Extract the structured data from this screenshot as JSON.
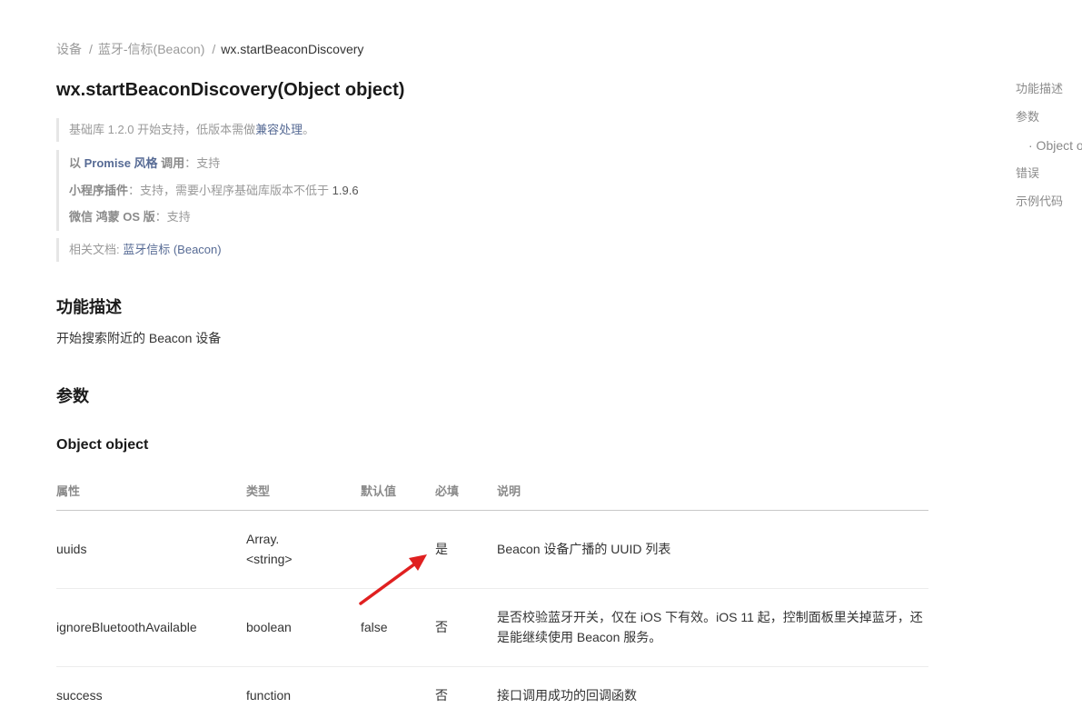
{
  "breadcrumb": {
    "items": [
      "设备",
      "蓝牙-信标(Beacon)"
    ],
    "separator": "/",
    "current": "wx.startBeaconDiscovery"
  },
  "title": "wx.startBeaconDiscovery(Object object)",
  "support_note": {
    "prefix": "基础库 1.2.0 开始支持，低版本需做",
    "link": "兼容处理",
    "suffix": "。"
  },
  "compat": {
    "promise": {
      "a": "以 ",
      "b": "Promise 风格",
      "c": " 调用",
      "colon": "：",
      "value": "支持"
    },
    "plugin": {
      "label": "小程序插件",
      "colon": "：",
      "value": "支持，需要小程序基础库版本不低于 ",
      "version": "1.9.6"
    },
    "harmony": {
      "label": "微信 鸿蒙 OS 版",
      "colon": "：",
      "value": "支持"
    }
  },
  "related": {
    "label": "相关文档: ",
    "link": "蓝牙信标 (Beacon)"
  },
  "sections": {
    "function_title": "功能描述",
    "function_desc": "开始搜索附近的 Beacon 设备",
    "params_title": "参数",
    "object_title": "Object object"
  },
  "table": {
    "headers": [
      "属性",
      "类型",
      "默认值",
      "必填",
      "说明"
    ],
    "rows": [
      {
        "attr": "uuids",
        "type": "Array.<string>",
        "default": "",
        "required": "是",
        "desc": "Beacon 设备广播的 UUID 列表"
      },
      {
        "attr": "ignoreBluetoothAvailable",
        "type": "boolean",
        "default": "false",
        "required": "否",
        "desc": "是否校验蓝牙开关，仅在 iOS 下有效。iOS 11 起，控制面板里关掉蓝牙，还是能继续使用 Beacon 服务。"
      },
      {
        "attr": "success",
        "type": "function",
        "default": "",
        "required": "否",
        "desc": "接口调用成功的回调函数"
      }
    ]
  },
  "toc": {
    "items": [
      "功能描述",
      "参数",
      "· Object object",
      "错误",
      "示例代码"
    ]
  },
  "colors": {
    "link": "#576b95",
    "annotation_arrow": "#e02020"
  }
}
